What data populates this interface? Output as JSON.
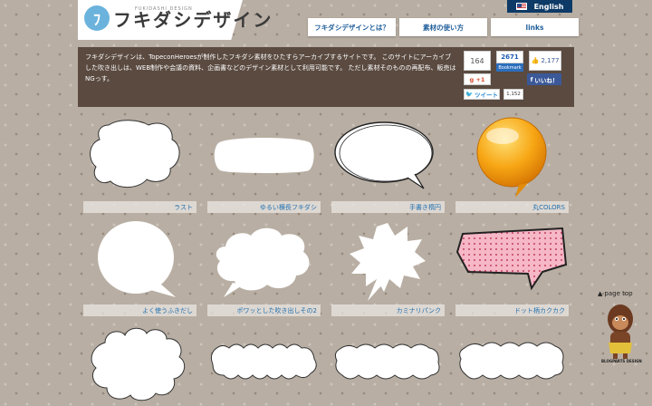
{
  "header": {
    "logo_mark": "ﾌ",
    "logo_text": "フキダシデザイン",
    "logo_sub": "FUKIDASHI DESIGN",
    "english": "English",
    "nav": [
      "フキダシデザインとは？",
      "素材の使い方",
      "links"
    ]
  },
  "intro": {
    "text": "フキダシデザインは、TopeconHeroesが制作したフキダシ素材をひたすらアーカイブするサイトです。 このサイトにアーカイブした吹き出しは、WEB制作や会議の資料、企画書などのデザイン素材として利用可能です。 ただし素材そのものの再配布、販売はNGっす。"
  },
  "social": {
    "hatena_count": "164",
    "gplus": "g +1",
    "bookmark_count": "2671",
    "bookmark_unit": "users",
    "bookmark_label": "Bookmark",
    "like_count": "2,177",
    "fb_like": "いいね！",
    "tweet": "ツイート",
    "tweet_count": "1,152"
  },
  "cards": [
    {
      "label": "ラスト"
    },
    {
      "label": "ゆるい横長フキダシ"
    },
    {
      "label": "手書き楕円"
    },
    {
      "label": "丸COLORS"
    },
    {
      "label": "よく使うふきだし"
    },
    {
      "label": "ポワッとした吹き出しその2"
    },
    {
      "label": "カミナリパンク"
    },
    {
      "label": "ドット柄カクカク"
    },
    {
      "label": ""
    },
    {
      "label": ""
    },
    {
      "label": ""
    },
    {
      "label": ""
    }
  ],
  "side": {
    "pagetop": "page top",
    "credit": "BLOGPARTS DESIGN"
  },
  "colors": {
    "accent": "#1f5e9a",
    "intro_bg": "#5a4a40",
    "english_bg": "#0d3a66"
  }
}
